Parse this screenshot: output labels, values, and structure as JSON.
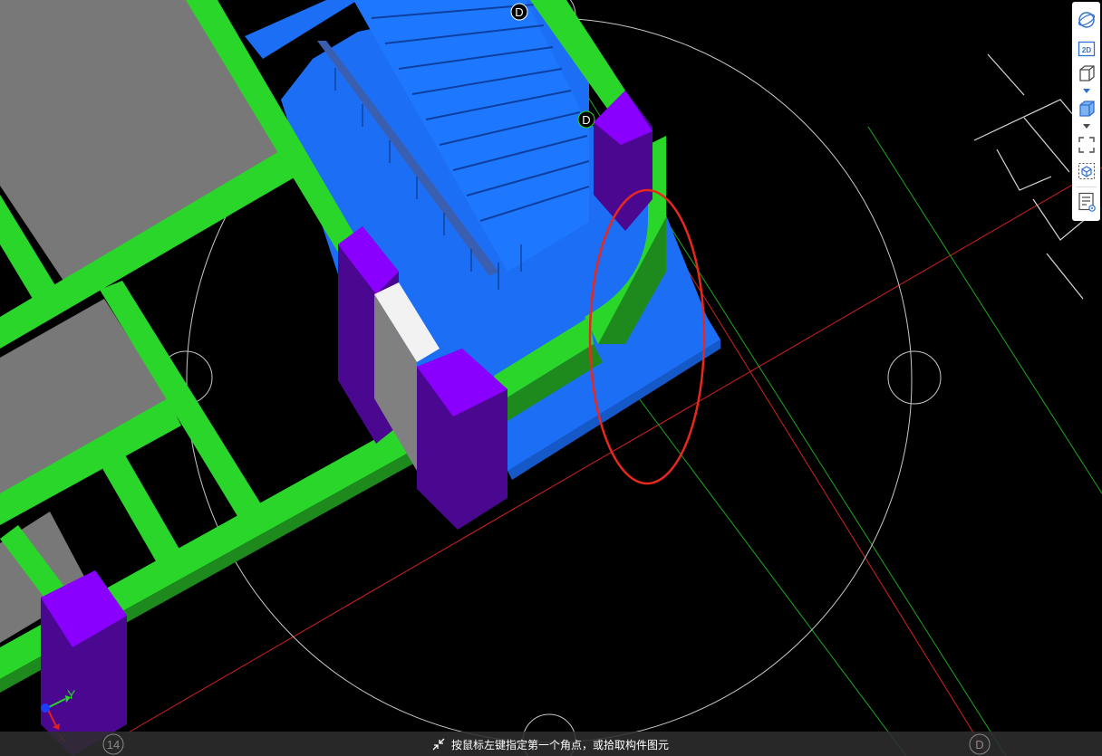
{
  "viewport": {
    "background_color": "#000000",
    "grid_markers": {
      "top_right_label": "D",
      "upper_right_label": "D",
      "bottom_left_label": "14",
      "bottom_right_label": "D"
    },
    "colors": {
      "beam": "#2bd62b",
      "slab": "#1c6ff5",
      "column": "#8a00ff",
      "floor": "#787878",
      "highlight_ellipse": "#e8281e",
      "grid_line_red": "#d42020",
      "grid_line_green": "#1fa81f",
      "guide_circle": "#c8c8c8"
    },
    "axis_indicator": {
      "y_label": "Y",
      "x_label": "X"
    }
  },
  "toolbar": {
    "items": [
      {
        "name": "orbit-view",
        "icon": "orbit-icon"
      },
      {
        "name": "2d-view",
        "icon": "2d-icon",
        "label": "2D"
      },
      {
        "name": "3d-box-view",
        "icon": "box-outline-icon"
      },
      {
        "name": "3d-solid-view",
        "icon": "box-solid-icon"
      },
      {
        "name": "fit-extent",
        "icon": "fullscreen-icon"
      },
      {
        "name": "select-box",
        "icon": "selection-box-icon"
      },
      {
        "name": "properties",
        "icon": "list-properties-icon"
      }
    ]
  },
  "status": {
    "hint": "按鼠标左键指定第一个角点，或拾取构件图元",
    "icon": "collapse-arrows-icon"
  }
}
